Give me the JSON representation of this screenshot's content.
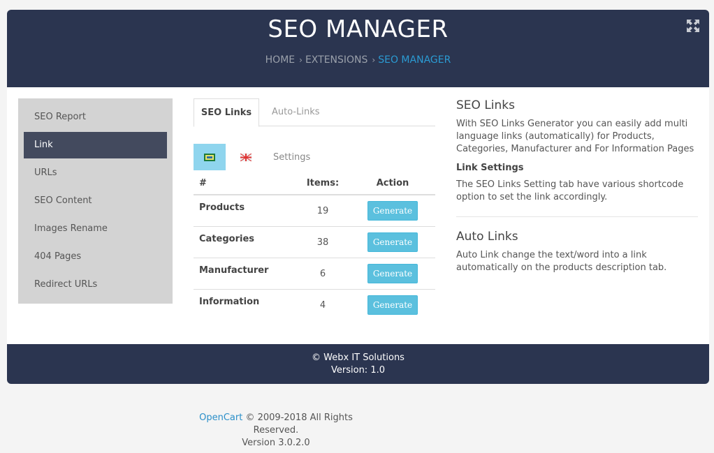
{
  "header": {
    "title": "SEO MANAGER",
    "breadcrumb": [
      {
        "label": "HOME"
      },
      {
        "label": "EXTENSIONS"
      },
      {
        "label": "SEO MANAGER"
      }
    ],
    "sep": "›"
  },
  "sidebar": {
    "items": [
      {
        "label": "SEO Report"
      },
      {
        "label": "Link"
      },
      {
        "label": "URLs"
      },
      {
        "label": "SEO Content"
      },
      {
        "label": "Images Rename"
      },
      {
        "label": "404 Pages"
      },
      {
        "label": "Redirect URLs"
      }
    ],
    "active_index": 1
  },
  "tabs": {
    "seo_links": "SEO Links",
    "auto_links": "Auto-Links"
  },
  "subtabs": {
    "settings": "Settings"
  },
  "table": {
    "headers": {
      "name": "#",
      "items": "Items:",
      "action": "Action"
    },
    "rows": [
      {
        "name": "Products",
        "count": "19",
        "button": "Generate"
      },
      {
        "name": "Categories",
        "count": "38",
        "button": "Generate"
      },
      {
        "name": "Manufacturer",
        "count": "6",
        "button": "Generate"
      },
      {
        "name": "Information",
        "count": "4",
        "button": "Generate"
      }
    ]
  },
  "info": {
    "seo_links_title": "SEO Links",
    "seo_links_text": "With SEO Links Generator you can easily add multi language links (automatically) for Products, Categories, Manufacturer and For Information Pages",
    "link_settings_title": "Link Settings",
    "link_settings_text": "The SEO Links Setting tab have various shortcode option to set the link accordingly.",
    "auto_links_title": "Auto Links",
    "auto_links_text": "Auto Link change the text/word into a link automatically on the products description tab."
  },
  "panel_footer": {
    "copyright": "© Webx IT Solutions",
    "version": "Version: 1.0"
  },
  "page_footer": {
    "link": "OpenCart",
    "text": " © 2009-2018 All Rights Reserved.",
    "version": "Version 3.0.2.0"
  },
  "colors": {
    "header_bg": "#2b3550",
    "accent": "#2b9bd3",
    "button": "#5bc0de",
    "sidebar_active": "#434a5e"
  }
}
